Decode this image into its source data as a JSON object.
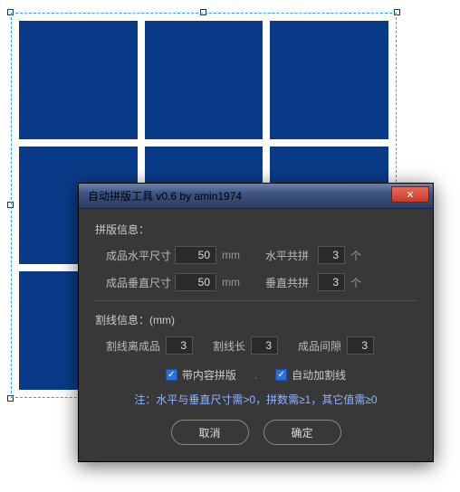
{
  "dialog": {
    "title": "自动拼版工具 v0.6   by amin1974",
    "section1_title": "拼版信息：",
    "h_size_label": "成品水平尺寸",
    "h_size_value": "50",
    "unit_mm": "mm",
    "h_count_label": "水平共拼",
    "h_count_value": "3",
    "unit_ge": "个",
    "v_size_label": "成品垂直尺寸",
    "v_size_value": "50",
    "v_count_label": "垂直共拼",
    "v_count_value": "3",
    "section2_title": "割线信息：(mm)",
    "cut_offset_label": "割线离成品",
    "cut_offset_value": "3",
    "cut_len_label": "割线长",
    "cut_len_value": "3",
    "gap_label": "成品间隙",
    "gap_value": "3",
    "chk1_label": "带内容拼版",
    "chk2_label": "自动加割线",
    "note": "注：水平与垂直尺寸需>0，拼数需≥1，其它值需≥0",
    "cancel": "取消",
    "ok": "确定"
  }
}
